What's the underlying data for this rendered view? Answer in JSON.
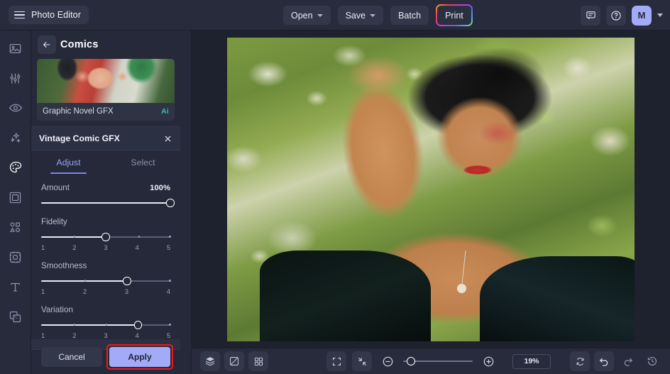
{
  "header": {
    "menu_icon": "hamburger-icon",
    "app_title": "Photo Editor",
    "buttons": [
      {
        "label": "Open",
        "has_chevron": true
      },
      {
        "label": "Save",
        "has_chevron": true
      },
      {
        "label": "Batch",
        "has_chevron": false
      },
      {
        "label": "Print",
        "has_chevron": false,
        "highlight": "rainbow-gradient-border"
      }
    ],
    "right": {
      "feedback_icon": "comment-icon",
      "help_icon": "help-circle-icon",
      "avatar_initial": "M",
      "avatar_color": "#a3abf7",
      "account_chevron": "chevron-down-icon"
    }
  },
  "rail": {
    "items": [
      {
        "icon": "image-icon",
        "active": false
      },
      {
        "icon": "adjustments-sliders-icon",
        "active": false
      },
      {
        "icon": "eye-icon",
        "active": false
      },
      {
        "icon": "sparkles-icon",
        "active": false
      },
      {
        "icon": "palette-icon",
        "active": true
      },
      {
        "icon": "frame-icon",
        "active": false
      },
      {
        "icon": "shapes-icon",
        "active": false
      },
      {
        "icon": "transform-crop-icon",
        "active": false
      },
      {
        "icon": "text-icon",
        "active": false
      },
      {
        "icon": "layers-overlay-icon",
        "active": false
      }
    ]
  },
  "panel": {
    "back_icon": "arrow-left-icon",
    "title": "Comics",
    "preset": {
      "name": "Graphic Novel GFX",
      "badge": "Ai",
      "badge_color": "#26c6a8"
    },
    "effect": {
      "title": "Vintage Comic GFX",
      "close_icon": "close-icon",
      "tabs": [
        {
          "label": "Adjust",
          "active": true
        },
        {
          "label": "Select",
          "active": false
        }
      ],
      "controls": [
        {
          "label": "Amount",
          "value_text": "100%",
          "percent": 100,
          "scale": []
        },
        {
          "label": "Fidelity",
          "value_text": "3",
          "percent": 50,
          "scale": [
            "1",
            "2",
            "3",
            "4",
            "5"
          ]
        },
        {
          "label": "Smoothness",
          "value_text": "3",
          "percent": 66.6,
          "scale": [
            "1",
            "2",
            "3",
            "4"
          ]
        },
        {
          "label": "Variation",
          "value_text": "4",
          "percent": 75,
          "scale": [
            "1",
            "2",
            "3",
            "4",
            "5"
          ]
        }
      ],
      "cancel_label": "Cancel",
      "apply_label": "Apply",
      "apply_highlighted": true,
      "highlight_color": "#f01818"
    },
    "scrollbar": {
      "up_arrow": "caret-up-icon",
      "down_arrow": "caret-down-icon"
    }
  },
  "canvas": {
    "image_alt": "Comic-styled portrait of a woman resting her head on her hand amid green foliage"
  },
  "bottombar": {
    "left_tools": [
      {
        "icon": "layers-stack-icon"
      },
      {
        "icon": "compare-split-icon"
      },
      {
        "icon": "grid-view-icon"
      }
    ],
    "view_tools": [
      {
        "icon": "fit-screen-icon"
      },
      {
        "icon": "actual-size-icon"
      }
    ],
    "zoom_out_icon": "zoom-out-icon",
    "zoom_in_icon": "zoom-in-icon",
    "zoom_percent": 11,
    "zoom_value": "19%",
    "right_tools": [
      {
        "icon": "reset-rotate-icon"
      },
      {
        "icon": "undo-icon"
      },
      {
        "icon": "redo-icon"
      },
      {
        "icon": "history-icon"
      }
    ]
  }
}
